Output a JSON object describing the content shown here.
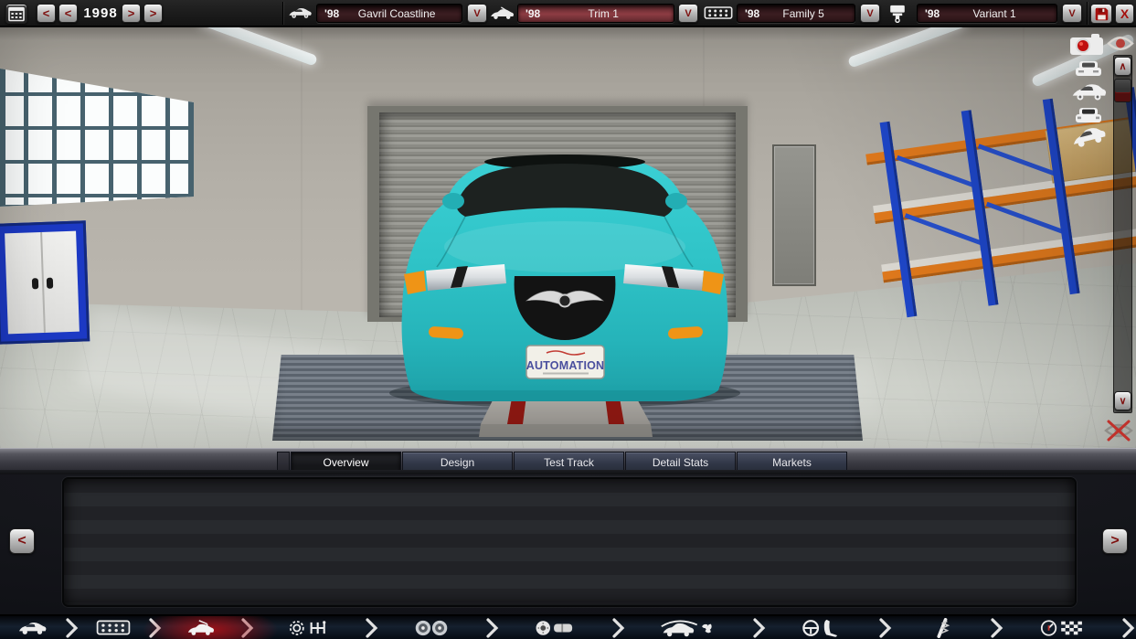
{
  "top_bar": {
    "year": "1998",
    "prev": "<",
    "next": ">",
    "dropdown_button": "V",
    "close": "X",
    "model": {
      "year": "'98",
      "name": "Gavril Coastline"
    },
    "trim": {
      "year": "'98",
      "name": "Trim 1"
    },
    "family": {
      "year": "'98",
      "name": "Family 5"
    },
    "variant": {
      "year": "'98",
      "name": "Variant 1"
    }
  },
  "viewport": {
    "license_plate": "AUTOMATION",
    "scroll_up": "∧",
    "scroll_down": "∨",
    "car_color": "#2fc3c7"
  },
  "tabs": [
    {
      "label": "Overview",
      "active": true
    },
    {
      "label": "Design",
      "active": false
    },
    {
      "label": "Test Track",
      "active": false
    },
    {
      "label": "Detail Stats",
      "active": false
    },
    {
      "label": "Markets",
      "active": false
    }
  ],
  "panel": {
    "prev": "<",
    "next": ">"
  },
  "toolbar": {
    "steps": [
      "car-body",
      "engine",
      "trim-model",
      "gearbox",
      "wheels",
      "brakes",
      "aero",
      "interior",
      "suspension",
      "test-track"
    ],
    "active_step_index": 2,
    "accent_color": "#a51016"
  }
}
